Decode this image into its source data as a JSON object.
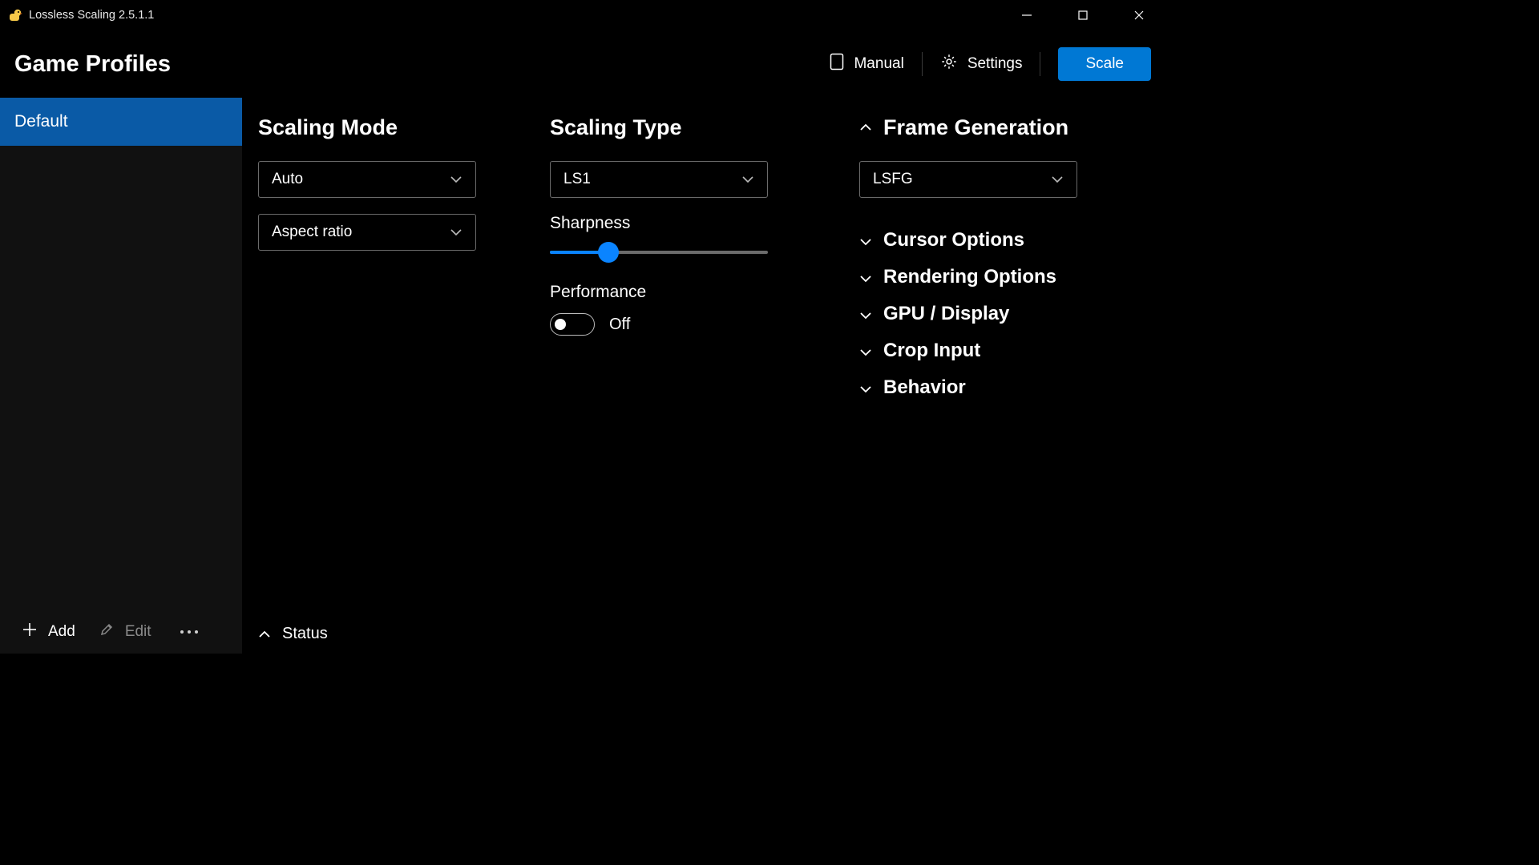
{
  "titlebar": {
    "title": "Lossless Scaling 2.5.1.1"
  },
  "header": {
    "page_title": "Game Profiles",
    "manual_label": "Manual",
    "settings_label": "Settings",
    "scale_label": "Scale"
  },
  "sidebar": {
    "profiles": [
      {
        "name": "Default",
        "selected": true
      }
    ],
    "add_label": "Add",
    "edit_label": "Edit"
  },
  "col1": {
    "title": "Scaling Mode",
    "combo1": "Auto",
    "combo2": "Aspect ratio"
  },
  "col2": {
    "title": "Scaling Type",
    "combo1": "LS1",
    "sharpness_label": "Sharpness",
    "sharpness_percent": 27,
    "performance_label": "Performance",
    "performance_state": "Off"
  },
  "col3": {
    "frame_gen_title": "Frame Generation",
    "frame_gen_combo": "LSFG",
    "accordions": [
      "Cursor Options",
      "Rendering Options",
      "GPU / Display",
      "Crop Input",
      "Behavior"
    ]
  },
  "status": {
    "label": "Status"
  }
}
